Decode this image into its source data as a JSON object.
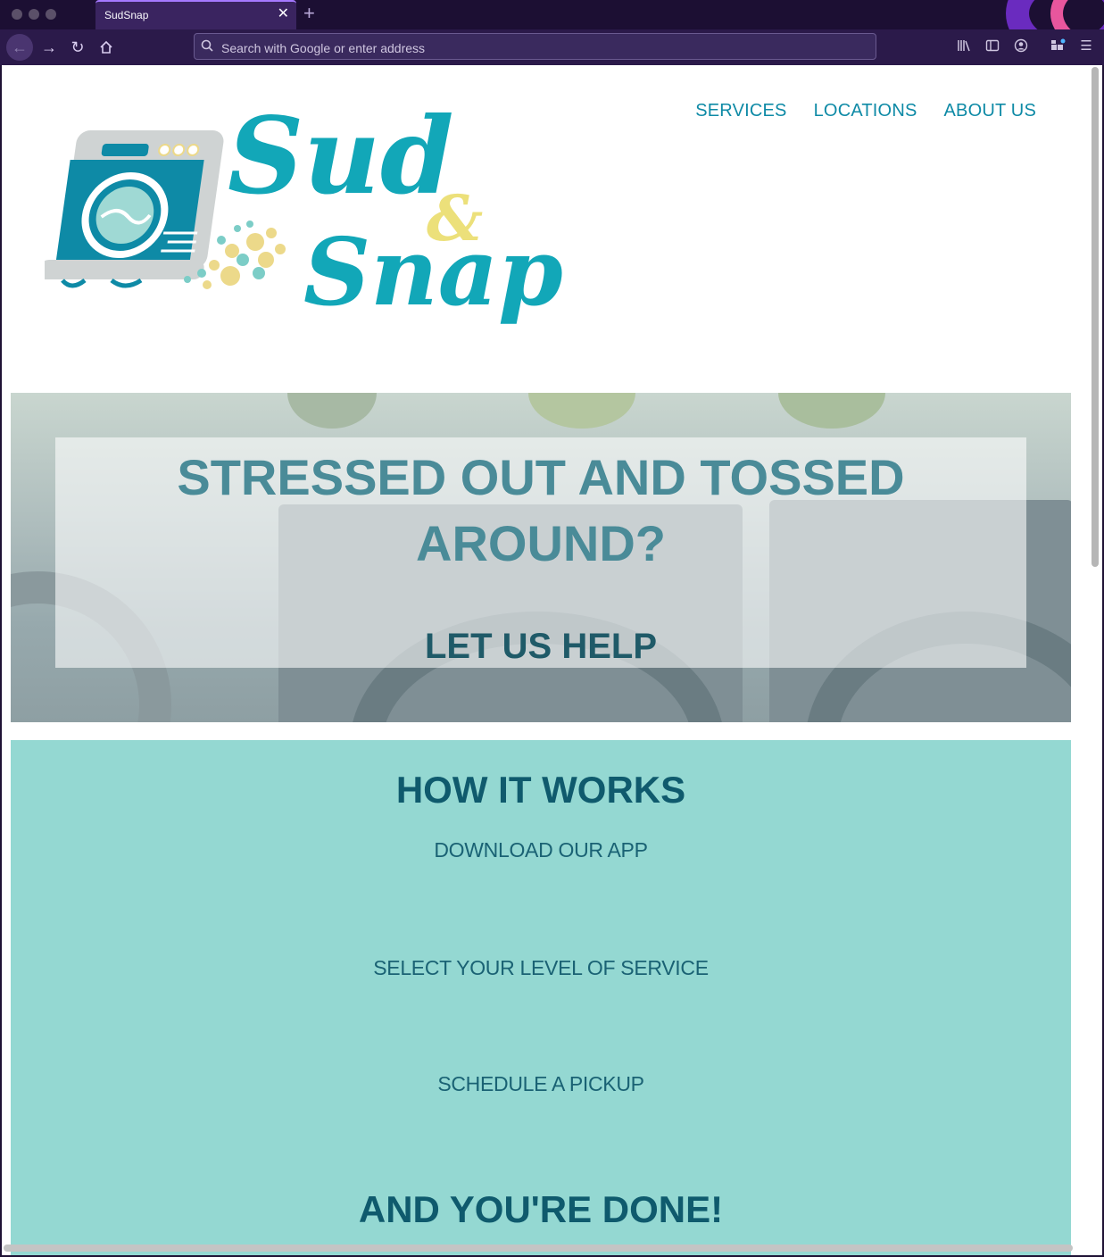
{
  "browser": {
    "tab_title": "SudSnap",
    "url_placeholder": "Search with Google or enter address",
    "icons": [
      "back-icon",
      "forward-icon",
      "reload-icon",
      "home-icon",
      "search-icon",
      "library-icon",
      "sidebar-icon",
      "account-icon",
      "extensions-icon",
      "menu-icon"
    ]
  },
  "header": {
    "logo": {
      "word1": "Sud",
      "ampersand": "&",
      "word2": "Snap"
    },
    "nav": [
      "SERVICES",
      "LOCATIONS",
      "ABOUT US"
    ]
  },
  "hero": {
    "headline_line1": "STRESSED OUT AND TOSSED",
    "headline_line2": "AROUND?",
    "subheadline": "LET US HELP"
  },
  "how_it_works": {
    "title": "HOW IT WORKS",
    "steps": [
      "DOWNLOAD OUR APP",
      "SELECT YOUR LEVEL OF SERVICE",
      "SCHEDULE A PICKUP"
    ],
    "closing": "AND YOU'RE DONE!"
  },
  "colors": {
    "brand_teal": "#12a7b8",
    "brand_yellow": "#ece07a",
    "nav_link": "#0e8aa6",
    "section_bg": "#94d8d2",
    "heading_dark": "#0f5a6d"
  }
}
